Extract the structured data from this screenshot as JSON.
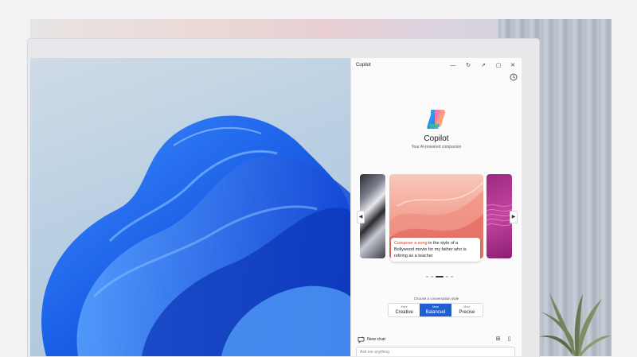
{
  "window": {
    "title": "Copilot",
    "controls": [
      "dock-icon",
      "refresh-icon",
      "open-external-icon",
      "restore-icon",
      "close-icon"
    ]
  },
  "icons": {
    "history": "history-icon"
  },
  "hero": {
    "brand": "Copilot",
    "tagline": "Your AI-powered companion"
  },
  "carousel": {
    "prompt_highlight": "Compose a song",
    "prompt_rest": " in the style of a Bollywood movie for my father who is retiring as a teacher",
    "active_dot": 2,
    "dot_count": 5
  },
  "conversation_style": {
    "label": "Choose a conversation style",
    "options": [
      {
        "prefix": "More",
        "label": "Creative",
        "active": false
      },
      {
        "prefix": "More",
        "label": "Balanced",
        "active": true
      },
      {
        "prefix": "More",
        "label": "Precise",
        "active": false
      }
    ]
  },
  "footer": {
    "new_chat": "New chat",
    "ask_placeholder": "Ask me anything"
  },
  "colors": {
    "accent": "#1f5fd0",
    "prompt_highlight": "#d43b2c"
  }
}
